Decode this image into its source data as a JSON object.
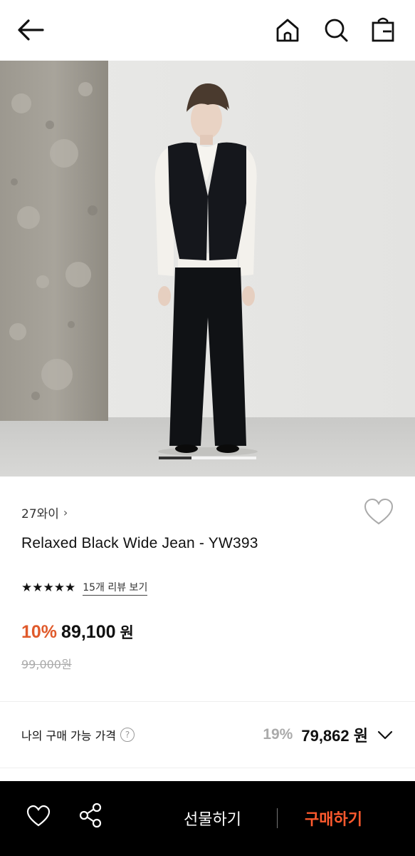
{
  "header": {
    "back_icon": "arrow-left-icon",
    "home_icon": "home-icon",
    "search_icon": "search-icon",
    "bag_icon": "shopping-bag-icon"
  },
  "gallery": {
    "current_image": 1,
    "total_images": 3
  },
  "product": {
    "brand": "27와이",
    "name": "Relaxed Black Wide Jean - YW393",
    "stars": "★★★★★",
    "review_link": "15개 리뷰 보기",
    "discount": "10%",
    "price": "89,100",
    "price_unit": "원",
    "original_price": "99,000원"
  },
  "my_price": {
    "label": "나의 구매 가능 가격",
    "help": "?",
    "rate": "19%",
    "price": "79,862 원"
  },
  "bottom_bar": {
    "gift_label": "선물하기",
    "buy_label": "구매하기"
  },
  "colors": {
    "accent": "#e05a2b",
    "buy": "#ff5a2e",
    "bar_bg": "#000000"
  }
}
